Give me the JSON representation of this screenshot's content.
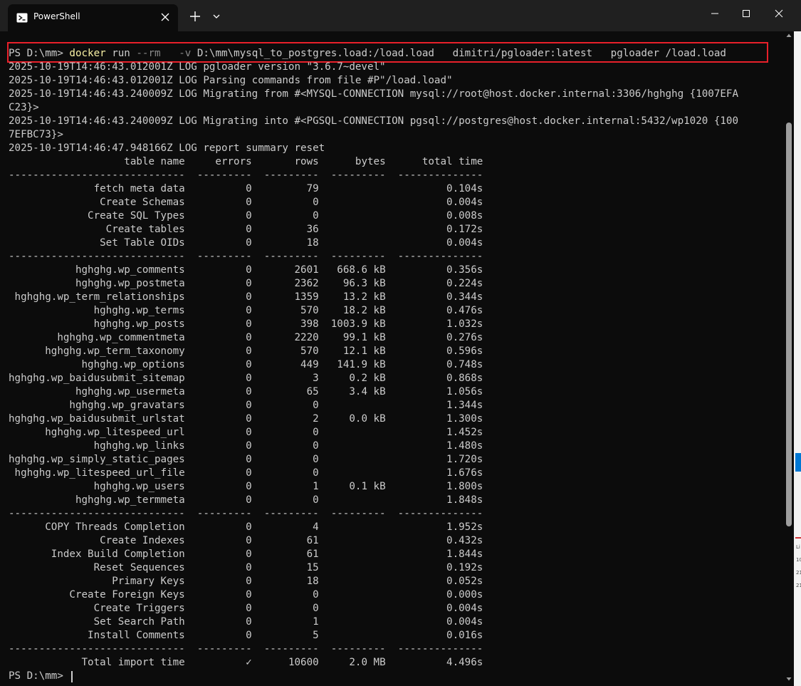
{
  "window": {
    "tab_title": "PowerShell",
    "tab_icon": "powershell-icon",
    "newtab_icon": "plus-icon",
    "dropdown_icon": "chevron-down-icon",
    "minimize_icon": "minimize-icon",
    "maximize_icon": "maximize-icon",
    "close_icon": "close-icon"
  },
  "colors": {
    "terminal_bg": "#0c0c0c",
    "text": "#cccccc",
    "command": "#f9f1a5",
    "param": "#8a8a8a",
    "highlight_border": "#e8202a"
  },
  "command": {
    "prompt": "PS D:\\mm> ",
    "cmd": "docker",
    "arg1": " run ",
    "flag1": "--rm",
    "sp1": "   ",
    "flag2": "-v",
    "rest": " D:\\mm\\mysql_to_postgres.load:/load.load   dimitri/pgloader:latest   pgloader /load.load"
  },
  "log_lines": [
    "2025-10-19T14:46:43.012001Z LOG pgloader version \"3.6.7~devel\"",
    "2025-10-19T14:46:43.012001Z LOG Parsing commands from file #P\"/load.load\"",
    "2025-10-19T14:46:43.240009Z LOG Migrating from #<MYSQL-CONNECTION mysql://root@host.docker.internal:3306/hghghg {1007EFA",
    "C23}>",
    "2025-10-19T14:46:43.240009Z LOG Migrating into #<PGSQL-CONNECTION pgsql://postgres@host.docker.internal:5432/wp1020 {100",
    "7EFBC73}>",
    "2025-10-19T14:46:47.948166Z LOG report summary reset"
  ],
  "table": {
    "columns": [
      "table name",
      "errors",
      "rows",
      "bytes",
      "total time"
    ],
    "separator": "-----------------------------  ---------  ---------  ---------  --------------",
    "prep_rows": [
      [
        "fetch meta data",
        "0",
        "79",
        "",
        "0.104s"
      ],
      [
        "Create Schemas",
        "0",
        "0",
        "",
        "0.004s"
      ],
      [
        "Create SQL Types",
        "0",
        "0",
        "",
        "0.008s"
      ],
      [
        "Create tables",
        "0",
        "36",
        "",
        "0.172s"
      ],
      [
        "Set Table OIDs",
        "0",
        "18",
        "",
        "0.004s"
      ]
    ],
    "data_rows": [
      [
        "hghghg.wp_comments",
        "0",
        "2601",
        "668.6 kB",
        "0.356s"
      ],
      [
        "hghghg.wp_postmeta",
        "0",
        "2362",
        "96.3 kB",
        "0.224s"
      ],
      [
        "hghghg.wp_term_relationships",
        "0",
        "1359",
        "13.2 kB",
        "0.344s"
      ],
      [
        "hghghg.wp_terms",
        "0",
        "570",
        "18.2 kB",
        "0.476s"
      ],
      [
        "hghghg.wp_posts",
        "0",
        "398",
        "1003.9 kB",
        "1.032s"
      ],
      [
        "hghghg.wp_commentmeta",
        "0",
        "2220",
        "99.1 kB",
        "0.276s"
      ],
      [
        "hghghg.wp_term_taxonomy",
        "0",
        "570",
        "12.1 kB",
        "0.596s"
      ],
      [
        "hghghg.wp_options",
        "0",
        "449",
        "141.9 kB",
        "0.748s"
      ],
      [
        "hghghg.wp_baidusubmit_sitemap",
        "0",
        "3",
        "0.2 kB",
        "0.868s"
      ],
      [
        "hghghg.wp_usermeta",
        "0",
        "65",
        "3.4 kB",
        "1.056s"
      ],
      [
        "hghghg.wp_gravatars",
        "0",
        "0",
        "",
        "1.344s"
      ],
      [
        "hghghg.wp_baidusubmit_urlstat",
        "0",
        "2",
        "0.0 kB",
        "1.300s"
      ],
      [
        "hghghg.wp_litespeed_url",
        "0",
        "0",
        "",
        "1.452s"
      ],
      [
        "hghghg.wp_links",
        "0",
        "0",
        "",
        "1.480s"
      ],
      [
        "hghghg.wp_simply_static_pages",
        "0",
        "0",
        "",
        "1.720s"
      ],
      [
        "hghghg.wp_litespeed_url_file",
        "0",
        "0",
        "",
        "1.676s"
      ],
      [
        "hghghg.wp_users",
        "0",
        "1",
        "0.1 kB",
        "1.800s"
      ],
      [
        "hghghg.wp_termmeta",
        "0",
        "0",
        "",
        "1.848s"
      ]
    ],
    "post_rows": [
      [
        "COPY Threads Completion",
        "0",
        "4",
        "",
        "1.952s"
      ],
      [
        "Create Indexes",
        "0",
        "61",
        "",
        "0.432s"
      ],
      [
        "Index Build Completion",
        "0",
        "61",
        "",
        "1.844s"
      ],
      [
        "Reset Sequences",
        "0",
        "15",
        "",
        "0.192s"
      ],
      [
        "Primary Keys",
        "0",
        "18",
        "",
        "0.052s"
      ],
      [
        "Create Foreign Keys",
        "0",
        "0",
        "",
        "0.000s"
      ],
      [
        "Create Triggers",
        "0",
        "0",
        "",
        "0.004s"
      ],
      [
        "Set Search Path",
        "0",
        "1",
        "",
        "0.004s"
      ],
      [
        "Install Comments",
        "0",
        "5",
        "",
        "0.016s"
      ]
    ],
    "total_row": [
      "Total import time",
      "✓",
      "10600",
      "2.0 MB",
      "4.496s"
    ]
  },
  "final_prompt": "PS D:\\mm> ",
  "background_window": {
    "text": [
      "Li",
      "10",
      "21",
      "21"
    ]
  }
}
